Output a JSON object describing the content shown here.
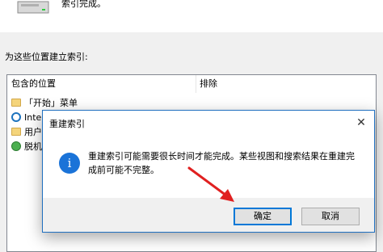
{
  "window": {
    "status_text": "索引完成。",
    "section_label": "为这些位置建立索引:"
  },
  "locations": {
    "headers": {
      "included": "包含的位置",
      "exclude": "排除"
    },
    "items": [
      {
        "label": "「开始」菜单",
        "icon": "folder-icon"
      },
      {
        "label": "Inter",
        "icon": "internet-explorer-icon"
      },
      {
        "label": "用户",
        "icon": "folder-icon"
      },
      {
        "label": "脱机",
        "icon": "offline-files-icon"
      }
    ]
  },
  "dialog": {
    "title": "重建索引",
    "close_glyph": "✕",
    "info_glyph": "i",
    "message": "重建索引可能需要很长时间才能完成。某些视图和搜索结果在重建完成前可能不完整。",
    "ok_label": "确定",
    "cancel_label": "取消"
  },
  "colors": {
    "accent": "#0078d7",
    "arrow": "#e02020",
    "info_icon": "#1a73d8"
  }
}
